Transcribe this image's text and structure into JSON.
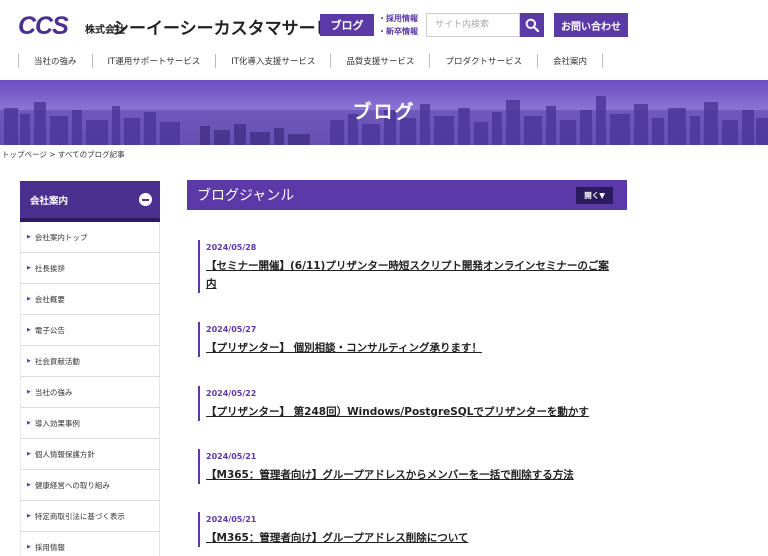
{
  "header": {
    "logo": "CCS",
    "company_prefix": "株式会社",
    "company_name": "シーイーシーカスタマサービス",
    "blog_button": "ブログ",
    "recruit_link": "・採用情報",
    "graduate_link": "・新卒情報",
    "search_placeholder": "サイト内検索",
    "contact_button": "お問い合わせ"
  },
  "nav": {
    "items": [
      "当社の強み",
      "IT運用サポートサービス",
      "IT化導入支援サービス",
      "品質支援サービス",
      "プロダクトサービス",
      "会社案内"
    ]
  },
  "hero": {
    "title": "ブログ"
  },
  "breadcrumb": "トップページ > すべてのブログ記事",
  "sidebar": {
    "title": "会社案内",
    "items": [
      "会社案内トップ",
      "社長挨拶",
      "会社概要",
      "電子公告",
      "社会貢献活動",
      "当社の強み",
      "導入効果事例",
      "個人情報保護方針",
      "健康経営への取り組み",
      "特定商取引法に基づく表示",
      "採用情報"
    ]
  },
  "genre": {
    "title": "ブログジャンル",
    "open_button": "開く▼"
  },
  "posts": [
    {
      "date": "2024/05/28",
      "title": "【セミナー開催】(6/11)プリザンター時短スクリプト開発オンラインセミナーのご案内"
    },
    {
      "date": "2024/05/27",
      "title": "【プリザンター】 個別相談・コンサルティング承ります！"
    },
    {
      "date": "2024/05/22",
      "title": "【プリザンター】 第248回）Windows/PostgreSQLでプリザンターを動かす"
    },
    {
      "date": "2024/05/21",
      "title": "【M365：管理者向け】グループアドレスからメンバーを一括で削除する方法"
    },
    {
      "date": "2024/05/21",
      "title": "【M365：管理者向け】グループアドレス削除について"
    }
  ],
  "colors": {
    "brand": "#5b3aa8",
    "brand_dark": "#4a2f8f",
    "accent_dark": "#2b1a5e"
  },
  "icons": {
    "search": "search-icon",
    "collapse": "minus-circle-icon",
    "bullet": "triangle-right-icon"
  }
}
